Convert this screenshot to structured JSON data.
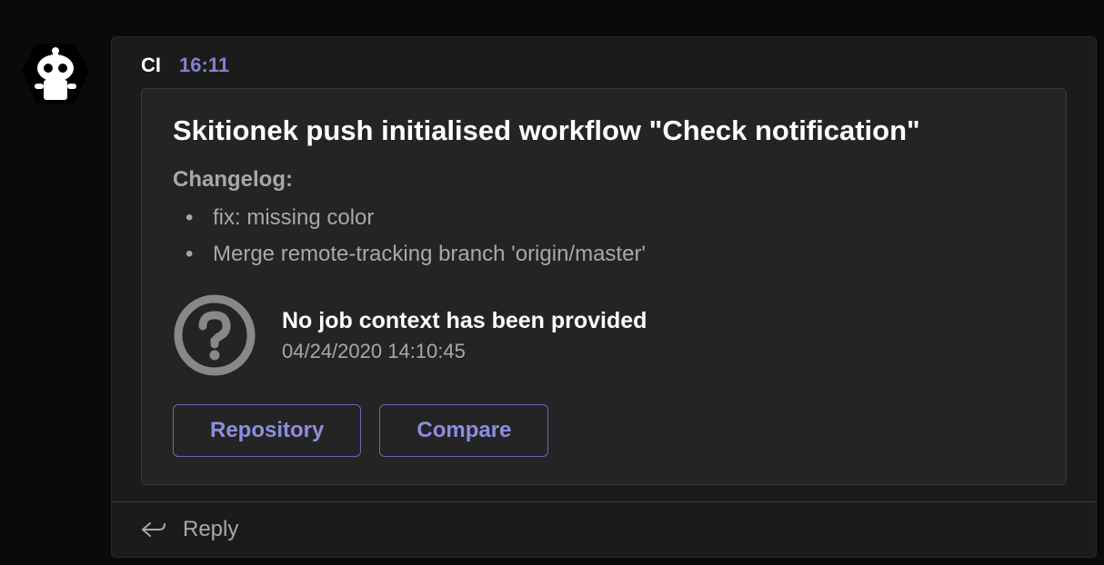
{
  "message": {
    "sender": "CI",
    "timestamp": "16:11"
  },
  "card": {
    "title": "Skitionek push initialised workflow \"Check notification\"",
    "changelog_label": "Changelog:",
    "changelog_items": [
      "fix: missing color",
      "Merge remote-tracking branch 'origin/master'"
    ],
    "status": {
      "title": "No job context has been provided",
      "date": "04/24/2020 14:10:45"
    },
    "buttons": {
      "repository": "Repository",
      "compare": "Compare"
    }
  },
  "reply": {
    "label": "Reply"
  }
}
